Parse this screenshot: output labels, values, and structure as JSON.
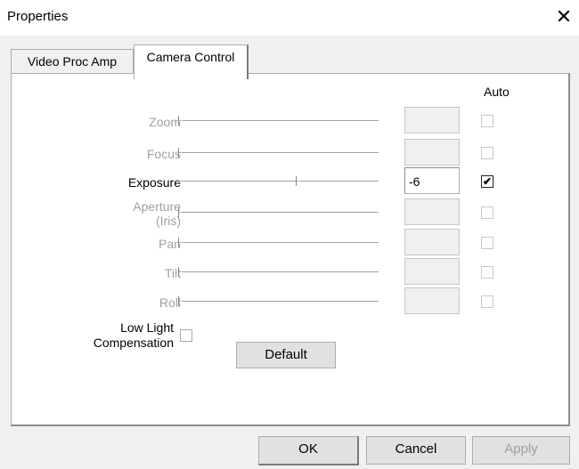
{
  "window": {
    "title": "Properties",
    "close_glyph": "✕"
  },
  "tabs": [
    {
      "label": "Video Proc Amp",
      "active": false
    },
    {
      "label": "Camera Control",
      "active": true
    }
  ],
  "auto_header": "Auto",
  "controls": [
    {
      "label": "Zoom",
      "enabled": false,
      "value": "",
      "auto": false,
      "slider_position": 0.0
    },
    {
      "label": "Focus",
      "enabled": false,
      "value": "",
      "auto": false,
      "slider_position": 0.0
    },
    {
      "label": "Exposure",
      "enabled": true,
      "value": "-6",
      "auto": true,
      "slider_position": 0.6
    },
    {
      "label_line1": "Aperture",
      "label_line2": "(Iris)",
      "enabled": false,
      "value": "",
      "auto": false,
      "slider_position": 0.0
    },
    {
      "label": "Pan",
      "enabled": false,
      "value": "",
      "auto": false,
      "slider_position": 0.0
    },
    {
      "label": "Tilt",
      "enabled": false,
      "value": "",
      "auto": false,
      "slider_position": 0.0
    },
    {
      "label": "Roll",
      "enabled": false,
      "value": "",
      "auto": false,
      "slider_position": 0.0
    }
  ],
  "low_light": {
    "label_line1": "Low Light",
    "label_line2": "Compensation",
    "checked": false
  },
  "buttons": {
    "default": "Default",
    "ok": "OK",
    "cancel": "Cancel",
    "apply": "Apply"
  }
}
